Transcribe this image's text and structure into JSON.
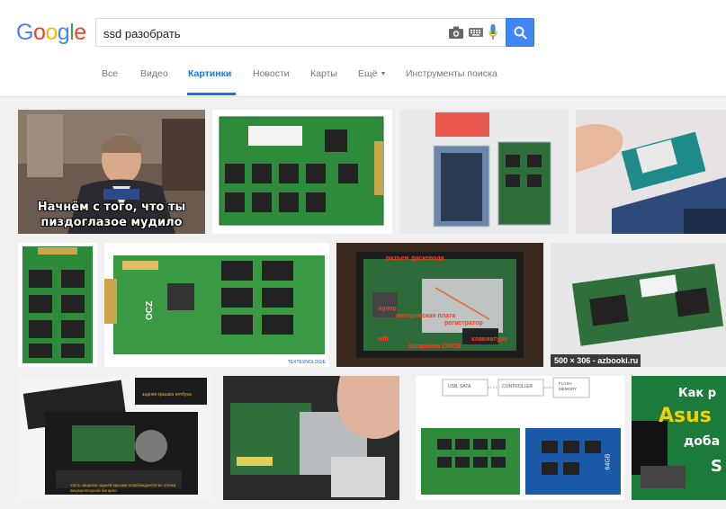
{
  "header": {
    "logo": {
      "letters": [
        "G",
        "o",
        "o",
        "g",
        "l",
        "e"
      ],
      "colors": [
        "#4285f4",
        "#ea4335",
        "#fbbc05",
        "#4285f4",
        "#34a853",
        "#ea4335"
      ]
    },
    "search": {
      "value": "ssd разобрать"
    },
    "icons": {
      "camera": "camera-icon",
      "keyboard": "keyboard-icon",
      "mic": "microphone-icon",
      "search": "search-icon"
    },
    "accent_color": "#4285f4"
  },
  "tabs": [
    {
      "label": "Все"
    },
    {
      "label": "Видео"
    },
    {
      "label": "Картинки",
      "active": true
    },
    {
      "label": "Новости"
    },
    {
      "label": "Карты"
    },
    {
      "label": "Ещё"
    },
    {
      "label": "Инструменты поиска"
    }
  ],
  "results": {
    "meme": {
      "line1": "Начнём с того, что ты",
      "line2": "пиздоглазое мудило"
    },
    "ocz": {
      "brand": "OCZ",
      "watermark": "TEXTEXNOLOGIE"
    },
    "laptop_open": {
      "labels": [
        "разъем дисковода",
        "материнская плата",
        "кулер",
        "регистратор",
        "батарейка CMOS",
        "клавиатура",
        "wifi"
      ]
    },
    "msata_caption": "500 × 306 - azbooki.ru",
    "laptop_back": {
      "label_top": "задняя крышка нетбука",
      "label_bottom": "часть защелок задней крышки освобождается из отсека аккумуляторной батареи"
    },
    "diagram": {
      "box1": "USB, SATA",
      "box2": "CONTROLLER",
      "box3": "FLASH MEMORY",
      "chip": "64GB"
    },
    "ad": {
      "line1": "Как р",
      "line2": "Asus",
      "line3": "доба",
      "line4": "S"
    }
  }
}
